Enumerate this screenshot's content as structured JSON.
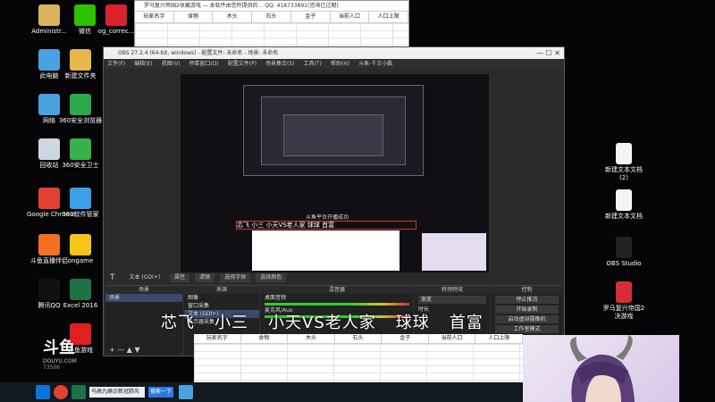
{
  "desktop_icons_left": [
    {
      "label": "Administr...",
      "icon": "user-folder-icon",
      "color": "#d9b45c"
    },
    {
      "label": "微信",
      "icon": "wechat-icon",
      "color": "#2dc100"
    },
    {
      "label": "og_correc...",
      "icon": "red-app-icon",
      "color": "#d8232a"
    },
    {
      "label": "此电脑",
      "icon": "computer-icon",
      "color": "#4aa3e0"
    },
    {
      "label": "新建文件夹",
      "icon": "folder-icon",
      "color": "#e8b84a"
    },
    {
      "label": "网络",
      "icon": "network-icon",
      "color": "#4aa3e0"
    },
    {
      "label": "360安全浏览器",
      "icon": "browser-360-icon",
      "color": "#2aa84a"
    },
    {
      "label": "回收站",
      "icon": "recycle-bin-icon",
      "color": "#cfd8e0"
    },
    {
      "label": "360安全卫士",
      "icon": "shield-360-icon",
      "color": "#37b14a"
    },
    {
      "label": "Google Chrome",
      "icon": "chrome-icon",
      "color": "#e34133"
    },
    {
      "label": "360软件管家",
      "icon": "software-manager-icon",
      "color": "#3aa0e8"
    },
    {
      "label": "斗鱼直播伴侣",
      "icon": "douyu-icon",
      "color": "#f37021"
    },
    {
      "label": "ongame",
      "icon": "ongame-icon",
      "color": "#f5c518"
    },
    {
      "label": "腾讯QQ",
      "icon": "qq-icon",
      "color": "#111111"
    },
    {
      "label": "Excel 2016",
      "icon": "excel-icon",
      "color": "#1f7244"
    },
    {
      "label": "斗鱼游戏",
      "icon": "douyu-game-icon",
      "color": "#e02020"
    }
  ],
  "desktop_icons_right": [
    {
      "label": "新建文本文档 (2)",
      "icon": "text-file-icon",
      "color": "#f4f4f4"
    },
    {
      "label": "新建文本文档",
      "icon": "text-file-icon",
      "color": "#f4f4f4"
    },
    {
      "label": "OBS Studio",
      "icon": "obs-icon",
      "color": "#222222"
    },
    {
      "label": "罗马复兴帝国2决游戏",
      "icon": "game-icon",
      "color": "#d82c3a"
    }
  ],
  "excel_top": {
    "title": "罗马复兴帝国2收藏游戏 — 本软件由您所提供的... QQ: 418733891(咨询已过期)",
    "headers": [
      "玩家名字",
      "食物",
      "木头",
      "石头",
      "金子",
      "当前人口",
      "人口上限"
    ]
  },
  "obs": {
    "title": "OBS 27.2.4 (64-bit, windows) - 配置文件: 未命名 - 场景: 未命名",
    "menu": [
      "文件(F)",
      "编辑(E)",
      "视图(V)",
      "停靠窗口(D)",
      "配置文件(P)",
      "场景集合(S)",
      "工具(T)",
      "帮助(H)",
      "斗鱼-千王小酷"
    ],
    "source_bar": {
      "name": "文本 (GDI+)",
      "props": "属性",
      "filters": "滤镜",
      "btn1": "选择字体",
      "btn2": "选择颜色"
    },
    "docks": {
      "scenes": "场景",
      "sources": "来源",
      "mixer": "混音器",
      "transitions": "转场特效",
      "controls": "控制"
    },
    "scene_items": [
      "场景"
    ],
    "source_items": [
      "图像",
      "窗口采集",
      "文本 (GDI+)",
      "显示器采集"
    ],
    "transition_value": "渐变",
    "transition_duration_label": "时长",
    "controls": [
      "停止推流",
      "开始录制",
      "启动虚拟摄像机",
      "工作室模式"
    ],
    "mixer_tracks": [
      "桌面音频",
      "麦克风/Aux"
    ],
    "inner_caption": "斗鱼平台开播成功",
    "inner_overlay": "芯飞 小三 小天VS老人家 球球 首富"
  },
  "overlay_names": [
    "芯飞",
    "小三",
    "小天VS老人家",
    "球球",
    "首富"
  ],
  "excel_bottom": {
    "headers": [
      "玩家名字",
      "食物",
      "木头",
      "石头",
      "金子",
      "当前人口",
      "人口上限"
    ]
  },
  "douyu_logo": {
    "text": "斗鱼",
    "sub": "DOUYU.COM",
    "room": "73506"
  },
  "taskbar": {
    "window_label": "马高九确诊新冠肺炎",
    "search_button": "搜索一下"
  }
}
